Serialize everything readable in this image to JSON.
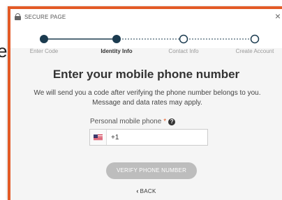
{
  "background": {
    "text": "e"
  },
  "header": {
    "secure_label": "SECURE PAGE",
    "lock_icon": "lock-icon",
    "close_label": "×"
  },
  "stepper": {
    "steps": [
      {
        "label": "Enter Code",
        "state": "complete"
      },
      {
        "label": "Identity Info",
        "state": "active"
      },
      {
        "label": "Contact Info",
        "state": "pending"
      },
      {
        "label": "Create Account",
        "state": "pending"
      }
    ],
    "colors": {
      "accent": "#1b3b4f",
      "inactive_text": "#999999"
    }
  },
  "main": {
    "heading": "Enter your mobile phone number",
    "description": "We will send you a code after verifying the phone number belongs to you. Message and data rates may apply.",
    "phone_field": {
      "label": "Personal mobile phone",
      "required_mark": "*",
      "help_icon": "?",
      "country_flag": "us-flag-icon",
      "value": "+1"
    },
    "verify_button": "VERIFY PHONE NUMBER",
    "back_link": "BACK",
    "back_icon": "‹"
  },
  "colors": {
    "border_accent": "#e35a26",
    "button_disabled": "#bdbdbd",
    "panel_bg": "#f5f5f5"
  }
}
